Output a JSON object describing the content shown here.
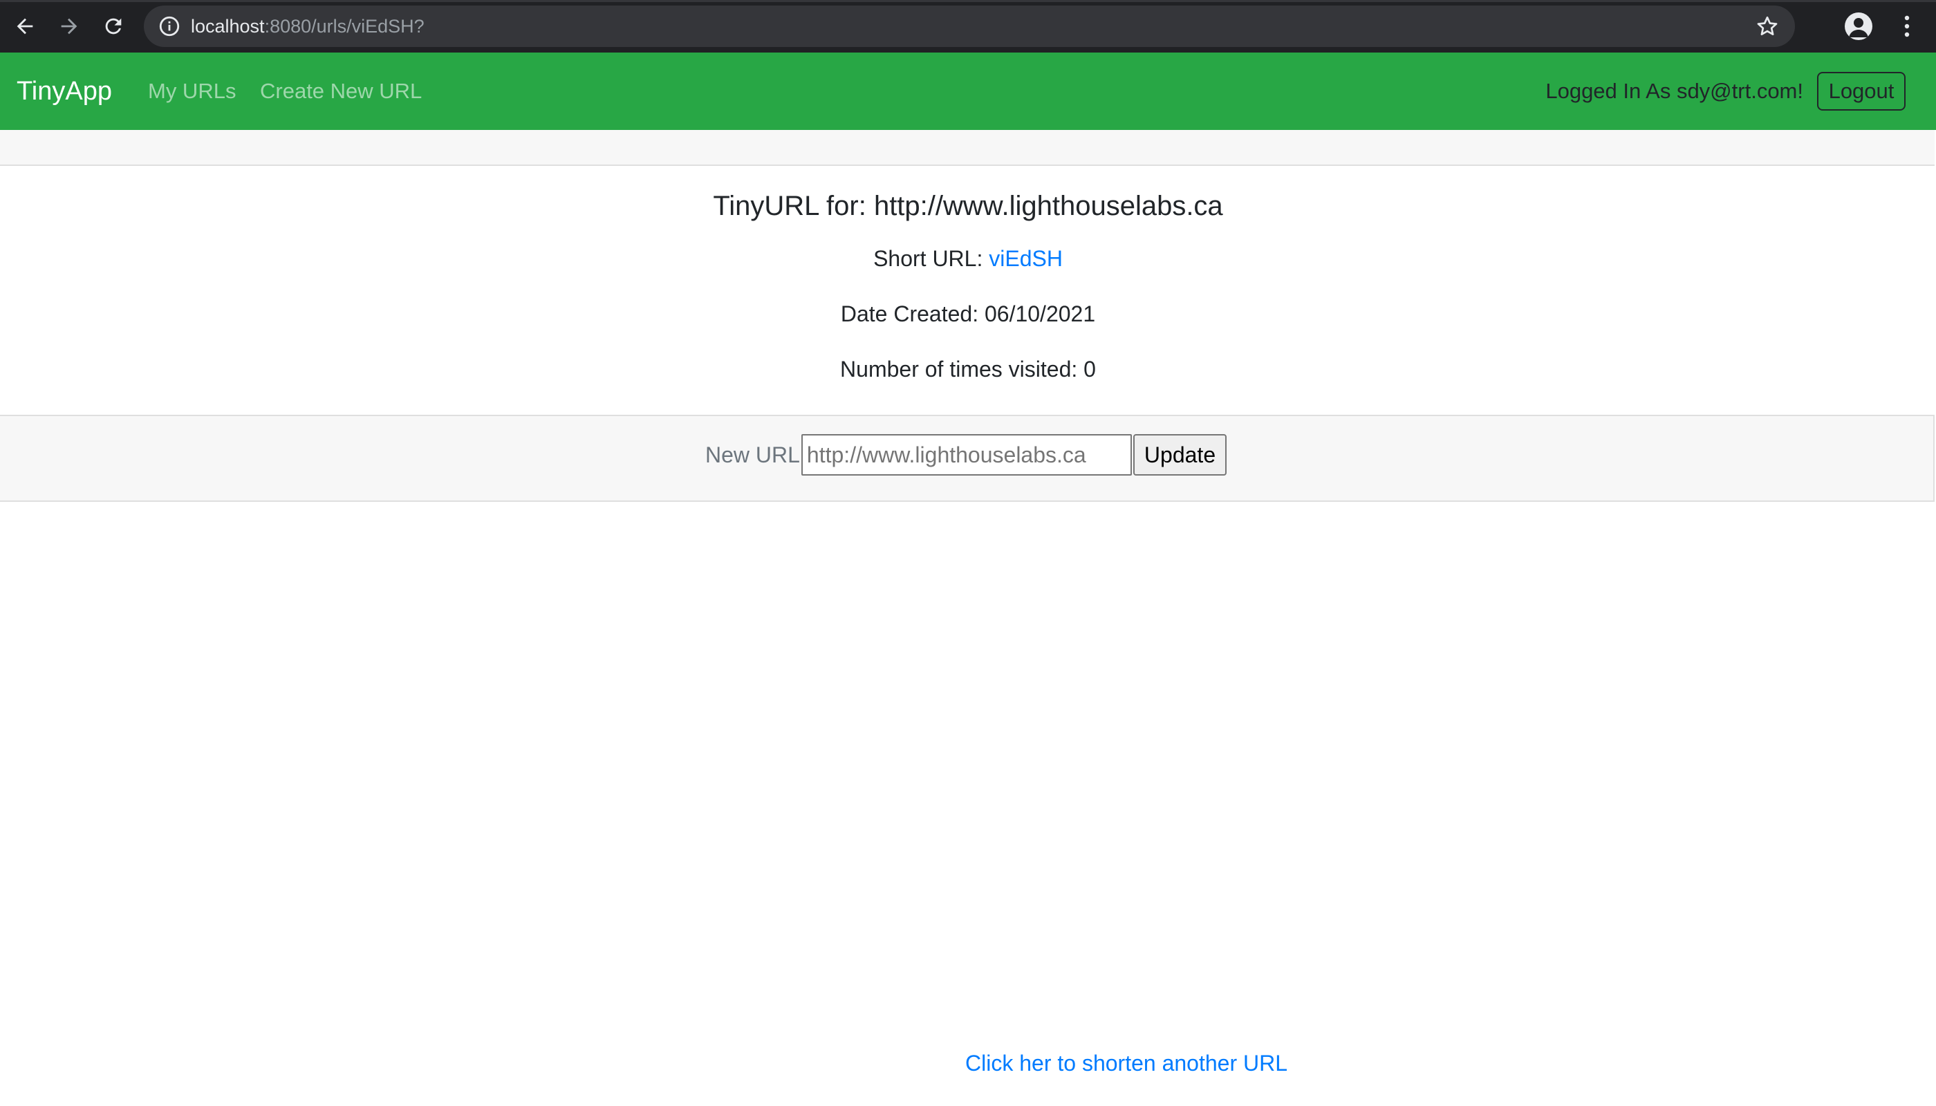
{
  "browser": {
    "url_host": "localhost",
    "url_path": ":8080/urls/viEdSH?"
  },
  "navbar": {
    "brand": "TinyApp",
    "links": [
      "My URLs",
      "Create New URL"
    ],
    "logged_in_text": "Logged In As sdy@trt.com!",
    "logout_label": "Logout",
    "bg_color": "#28a745"
  },
  "card": {
    "title": "TinyURL for: http://www.lighthouselabs.ca",
    "short_url_label": "Short URL:",
    "short_url_value": "viEdSH",
    "date_created": "Date Created: 06/10/2021",
    "visits": "Number of times visited: 0"
  },
  "form": {
    "label": "New URL",
    "placeholder": "http://www.lighthouselabs.ca",
    "submit_label": "Update"
  },
  "footer_link": "Click her to shorten another URL",
  "colors": {
    "link": "#007bff",
    "chrome_bg": "#202124"
  }
}
